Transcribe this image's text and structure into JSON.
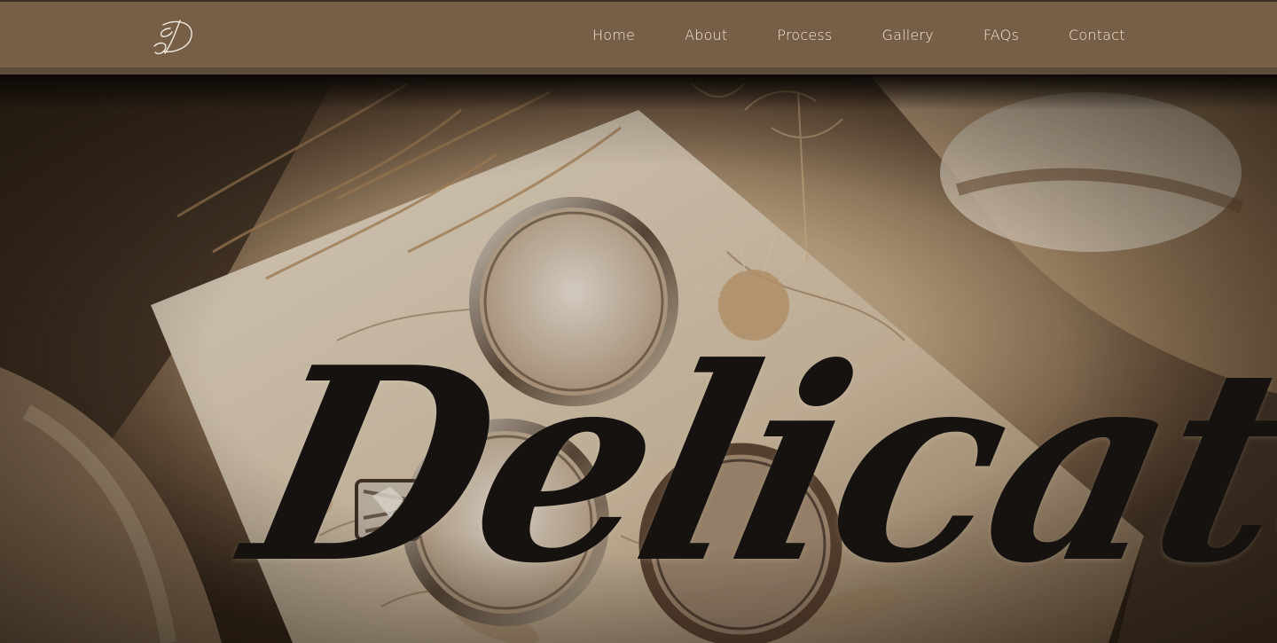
{
  "brand": {
    "logo_icon": "monogram-logo-icon",
    "colors": {
      "navbar": "#765f46",
      "nav_text": "#efe7dc",
      "title": "#151210"
    }
  },
  "nav": {
    "items": [
      {
        "label": "Home"
      },
      {
        "label": "About"
      },
      {
        "label": "Process"
      },
      {
        "label": "Gallery"
      },
      {
        "label": "FAQs"
      },
      {
        "label": "Contact"
      }
    ]
  },
  "hero": {
    "title": "Delicate"
  }
}
